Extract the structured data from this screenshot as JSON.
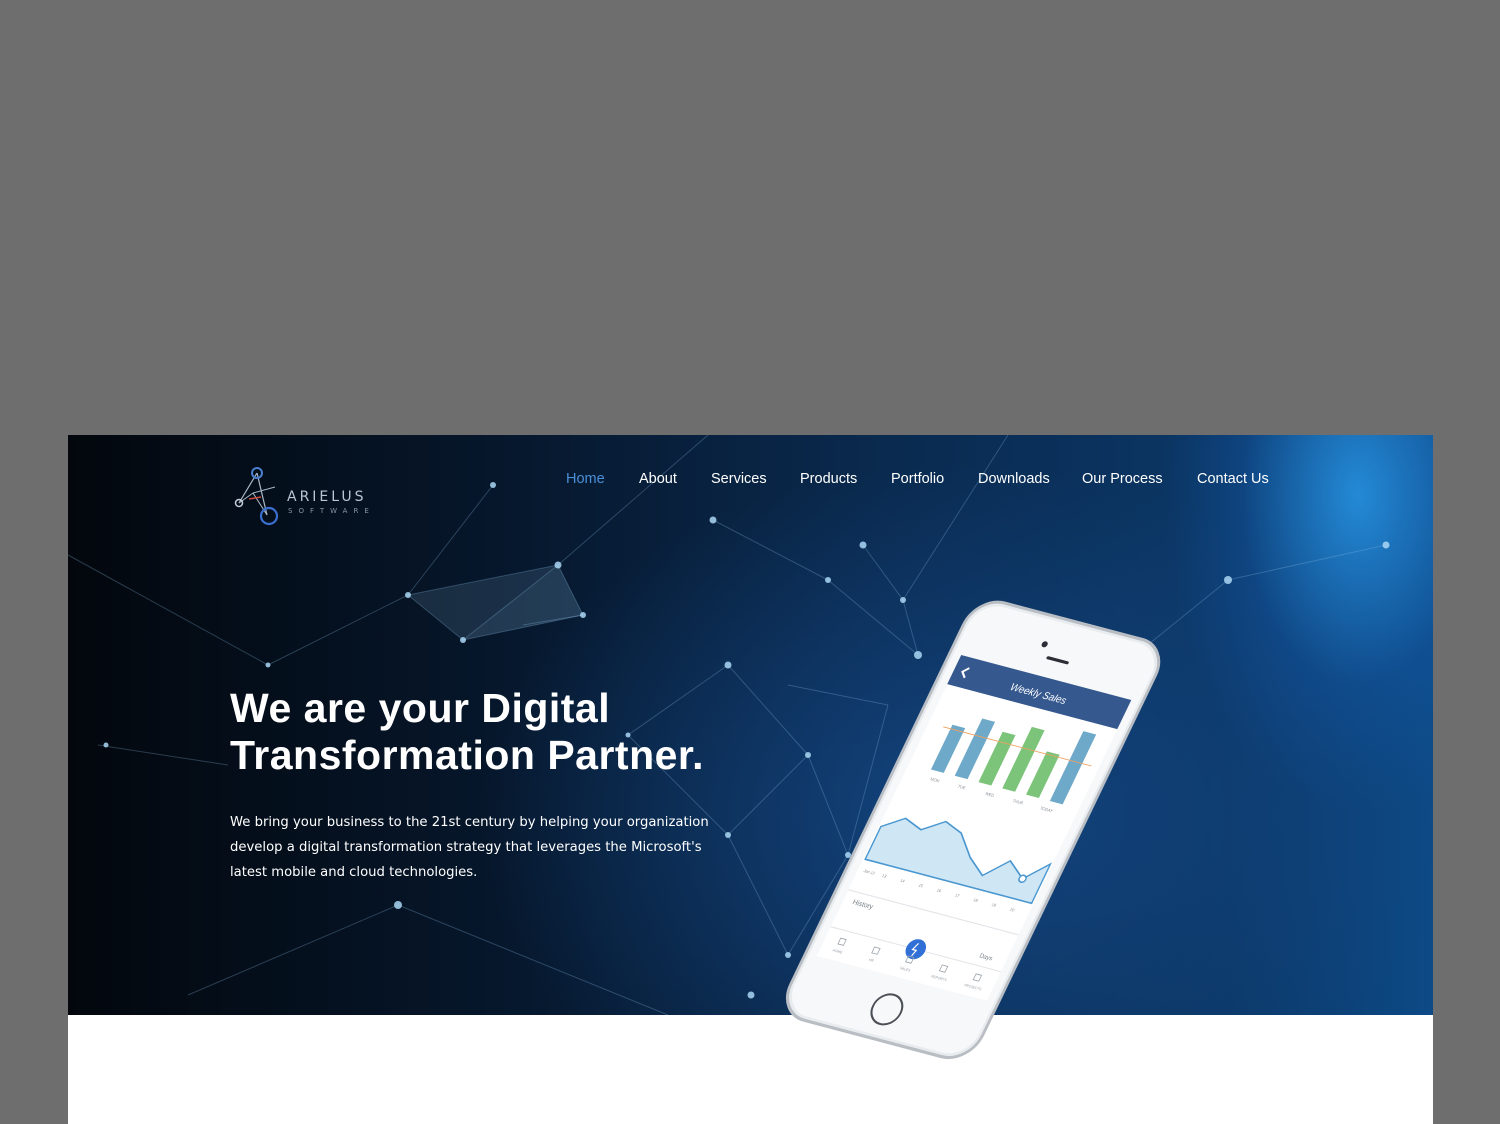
{
  "logo": {
    "name": "ARIELUS",
    "sub": "SOFTWARE"
  },
  "nav": {
    "items": [
      {
        "label": "Home",
        "active": true
      },
      {
        "label": "About"
      },
      {
        "label": "Services"
      },
      {
        "label": "Products"
      },
      {
        "label": "Portfolio"
      },
      {
        "label": "Downloads"
      },
      {
        "label": "Our Process"
      },
      {
        "label": "Contact Us"
      }
    ]
  },
  "hero": {
    "headline_line1": "We are your Digital",
    "headline_line2": "Transformation Partner.",
    "intro": "We bring your business to the 21st century by helping your organization develop a digital transformation strategy that leverages the Microsoft's latest mobile and cloud technologies."
  },
  "phone": {
    "screen_title": "Weekly Sales",
    "history_label": "History",
    "days_label": "Days",
    "bar_values": [
      3.2,
      4.1,
      3.6,
      4.4,
      3.1,
      5.0
    ],
    "bar_colors": [
      "#6ea9c9",
      "#6ea9c9",
      "#7cc47a",
      "#7cc47a",
      "#7cc47a",
      "#6ea9c9"
    ],
    "day_labels": [
      "MON",
      "TUE",
      "WED",
      "THUR",
      "TODAY"
    ],
    "area_values": [
      5,
      7,
      6,
      8,
      7,
      4,
      2,
      5,
      3,
      6
    ],
    "area_day_labels": [
      "Jan 12",
      "13",
      "14",
      "15",
      "16",
      "17",
      "18",
      "19",
      "20"
    ],
    "tab_labels": [
      "HOME",
      "HR",
      "SALES",
      "REPORTS",
      "PROJECTS"
    ]
  },
  "colors": {
    "active_nav": "#4a8fd8",
    "screen_header": "#35588f",
    "action_button": "#2f6fd6"
  }
}
